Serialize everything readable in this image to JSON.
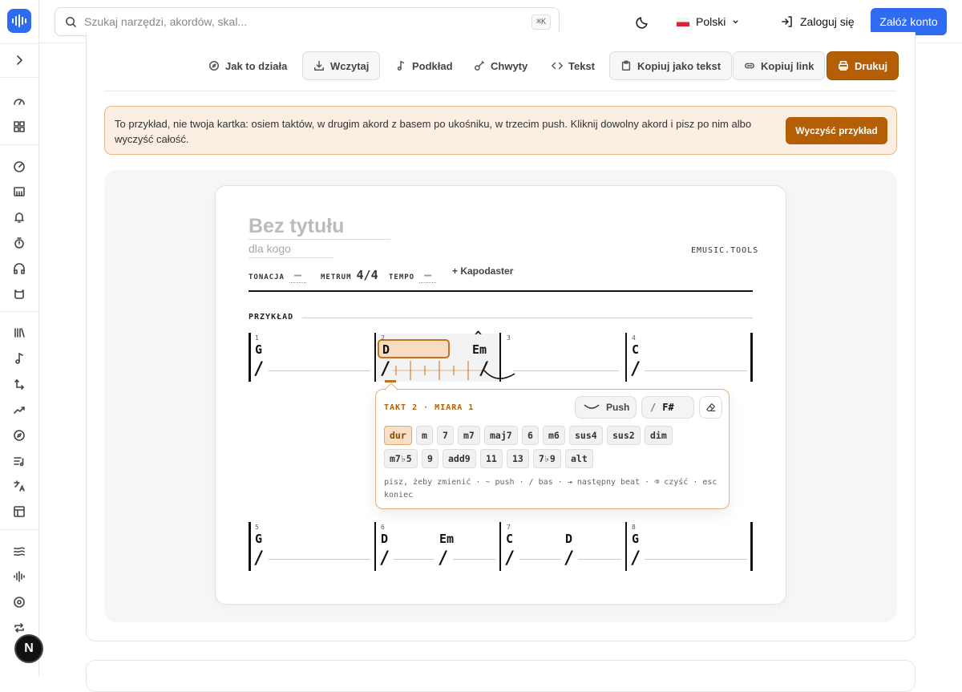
{
  "header": {
    "search_placeholder": "Szukaj narzędzi, akordów, skal...",
    "search_shortcut": "⌘K",
    "language": "Polski",
    "login": "Zaloguj się",
    "signup": "Załóż konto"
  },
  "sidebar": {
    "icons": [
      "expand-icon",
      "dashboard-icon",
      "grid-icon",
      "metronome-icon",
      "piano-icon",
      "bell-icon",
      "timer-icon",
      "headphones-icon",
      "cat-icon",
      "library-icon",
      "note-icon",
      "transpose-icon",
      "trend-icon",
      "compass-icon",
      "list-music-icon",
      "translate-icon",
      "table-icon",
      "waves-icon",
      "waveform-icon",
      "circle-icon",
      "loop-icon"
    ],
    "badge": "N"
  },
  "toolbar": {
    "how": "Jak to działa",
    "load": "Wczytaj",
    "backing": "Podkład",
    "grips": "Chwyty",
    "text": "Tekst",
    "copy_text": "Kopiuj jako tekst",
    "copy_link": "Kopiuj link",
    "print": "Drukuj"
  },
  "notice": {
    "text": "To przykład, nie twoja kartka: osiem taktów, w drugim akord z basem po ukośniku, w trzecim push. Kliknij dowolny akord i pisz po nim albo wyczyść całość.",
    "clear_button": "Wyczyść przykład"
  },
  "sheet": {
    "title": "Bez tytułu",
    "subtitle": "dla kogo",
    "brand": "EMUSIC.TOOLS",
    "key_label": "TONACJA",
    "key_value": "—",
    "meter_label": "METRUM",
    "meter_value": "4/4",
    "tempo_label": "TEMPO",
    "tempo_value": "—",
    "capo": "+ Kapodaster",
    "section": "PRZYKŁAD",
    "measures": [
      {
        "num": "1",
        "chords": [
          "G"
        ]
      },
      {
        "num": "2",
        "chords": [
          "D",
          "Em"
        ]
      },
      {
        "num": "3",
        "chords": []
      },
      {
        "num": "4",
        "chords": [
          "C"
        ]
      },
      {
        "num": "5",
        "chords": [
          "G"
        ]
      },
      {
        "num": "6",
        "chords": [
          "D",
          "Em"
        ]
      },
      {
        "num": "7",
        "chords": [
          "C",
          "D"
        ]
      },
      {
        "num": "8",
        "chords": [
          "G"
        ]
      }
    ],
    "push_mark": "^",
    "slash": "/"
  },
  "popover": {
    "heading": "TAKT 2 · MIARA 1",
    "push": "Push",
    "bass_prefix": "/",
    "bass_value": "F#",
    "qualities_row1": [
      "dur",
      "m",
      "7",
      "m7",
      "maj7",
      "6",
      "m6",
      "sus4",
      "sus2",
      "dim"
    ],
    "qualities_row2": [
      "m7♭5",
      "9",
      "add9",
      "11",
      "13",
      "7♭9",
      "alt"
    ],
    "selected": "dur",
    "hint": "pisz, żeby zmienić · ~ push · / bas · ⇥ następny beat · ⌫ czyść · esc koniec"
  }
}
